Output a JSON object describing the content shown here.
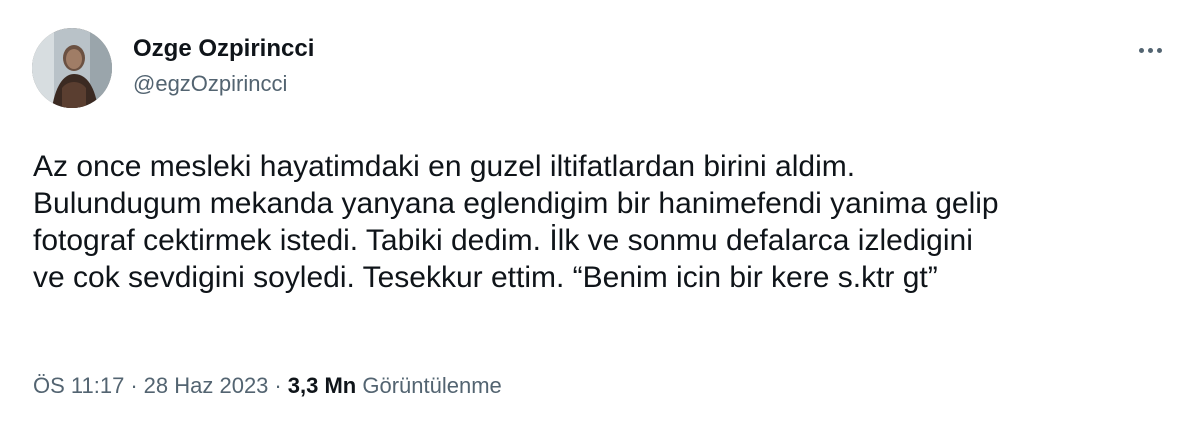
{
  "author": {
    "display_name": "Ozge Ozpirincci",
    "handle": "@egzOzpirincci"
  },
  "tweet": {
    "text": "Az once mesleki hayatimdaki en guzel iltifatlardan birini aldim.\nBulundugum mekanda yanyana eglendigim bir hanimefendi yanima gelip\nfotograf cektirmek istedi. Tabiki dedim. İlk ve sonmu defalarca izledigini\nve cok sevdigini soyledi. Tesekkur ettim. “Benim icin bir kere s.ktr gt”"
  },
  "meta": {
    "time": "ÖS 11:17",
    "separator": "·",
    "date": "28 Haz 2023",
    "views_count": "3,3 Mn",
    "views_label": "Görüntülenme"
  },
  "icons": {
    "more": "more-horizontal-icon",
    "avatar": "profile-photo"
  },
  "colors": {
    "text_primary": "#0f1419",
    "text_secondary": "#536471",
    "background": "#ffffff"
  }
}
